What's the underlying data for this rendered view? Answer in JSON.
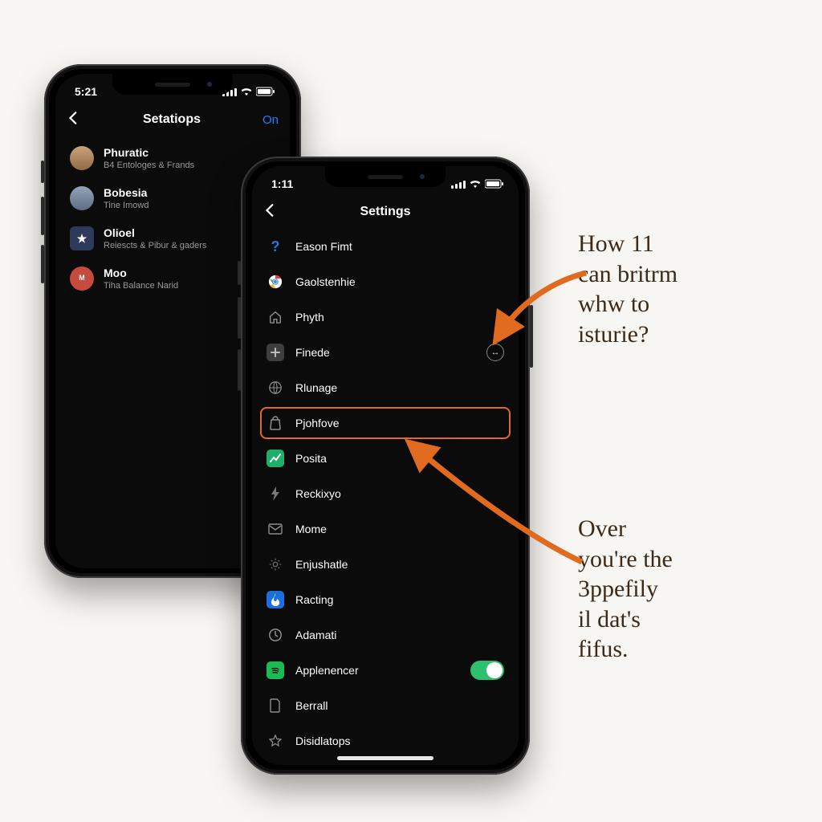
{
  "phone1": {
    "status_time": "5:21",
    "nav_title": "Setatiops",
    "nav_right": "On",
    "contacts": [
      {
        "name": "Phuratic",
        "sub": "B4 Entologes & Frands",
        "avatar_bg": "#b8916a"
      },
      {
        "name": "Bobesia",
        "sub": "Tine Imowd",
        "avatar_bg": "#7a8aa0"
      },
      {
        "name": "Olioel",
        "sub": "Reiescts & Pibur & gaders",
        "avatar_bg": "#3d4a6b"
      },
      {
        "name": "Moo",
        "sub": "Tiha Balance Narid",
        "avatar_bg": "#c64a3d"
      }
    ]
  },
  "phone2": {
    "status_time": "1:11",
    "nav_title": "Settings",
    "rows": [
      {
        "label": "Eason Fimt",
        "icon": "question",
        "icon_bg": "",
        "icon_color": "#2b74d4"
      },
      {
        "label": "Gaolstenhie",
        "icon": "chrome",
        "icon_bg": "",
        "icon_color": ""
      },
      {
        "label": "Phyth",
        "icon": "home",
        "icon_bg": "",
        "icon_color": "#8d8d8d"
      },
      {
        "label": "Finede",
        "icon": "plus-box",
        "icon_bg": "#3e3e3e",
        "icon_color": "#bcbcbc",
        "trailing": "more"
      },
      {
        "label": "Rlunage",
        "icon": "globe",
        "icon_bg": "",
        "icon_color": "#8d8d8d"
      },
      {
        "label": "Pjohfove",
        "icon": "bag",
        "icon_bg": "",
        "icon_color": "#8d8d8d",
        "highlighted": true
      },
      {
        "label": "Posita",
        "icon": "chart",
        "icon_bg": "#1db06a",
        "icon_color": "#fff"
      },
      {
        "label": "Reckixyo",
        "icon": "bolt",
        "icon_bg": "",
        "icon_color": "#7a7a7a"
      },
      {
        "label": "Mome",
        "icon": "mail",
        "icon_bg": "",
        "icon_color": "#8d8d8d"
      },
      {
        "label": "Enjushatle",
        "icon": "gear",
        "icon_bg": "",
        "icon_color": "#6f6f6f"
      },
      {
        "label": "Racting",
        "icon": "flame",
        "icon_bg": "#1d6fe0",
        "icon_color": "#fff"
      },
      {
        "label": "Adamati",
        "icon": "clock",
        "icon_bg": "",
        "icon_color": "#9a9a9a"
      },
      {
        "label": "Applenencer",
        "icon": "spotify",
        "icon_bg": "#1db954",
        "icon_color": "#fff",
        "trailing": "toggle-on"
      },
      {
        "label": "Berrall",
        "icon": "doc",
        "icon_bg": "",
        "icon_color": "#8d8d8d"
      },
      {
        "label": "Disidlatops",
        "icon": "star",
        "icon_bg": "",
        "icon_color": "#8d8d8d"
      }
    ]
  },
  "annotations": {
    "top": "How 11\ncan britrm\nwhw to\nisturie?",
    "bottom": "Over\nyou're the\n3ppefily\nil dat's\nfifus."
  },
  "colors": {
    "accent_orange": "#e06a1f",
    "ios_blue": "#1d82ff",
    "toggle_green": "#2fbf71"
  }
}
